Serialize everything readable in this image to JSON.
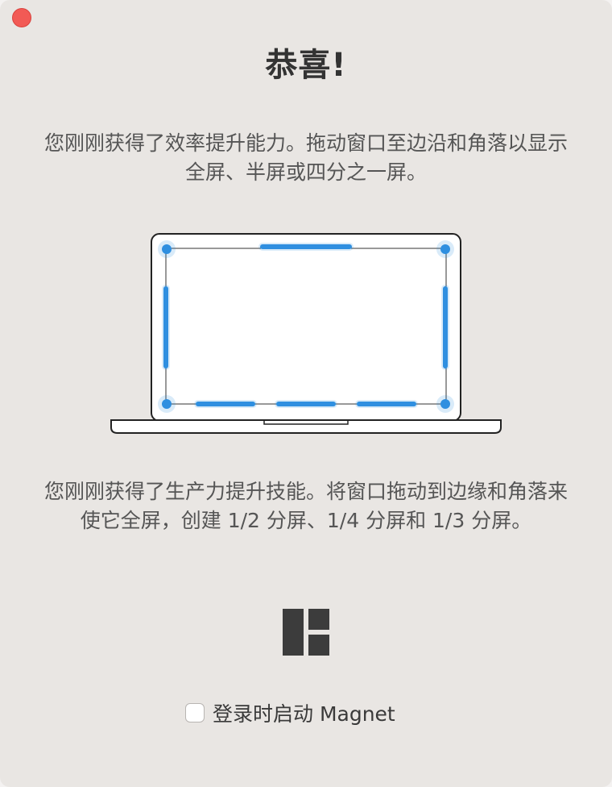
{
  "window": {
    "close_icon": "close-traffic-light"
  },
  "title": "恭喜!",
  "intro": "您刚刚获得了效率提升能力。拖动窗口至边沿和角落以显示全屏、半屏或四分之一屏。",
  "illustration": {
    "icon": "laptop-snap-zones-illustration"
  },
  "description": "您刚刚获得了生产力提升技能。将窗口拖动到边缘和角落来使它全屏，创建 1/2 分屏、1/4 分屏和 1/3 分屏。",
  "app_icon": "magnet-layout-icon",
  "launch_at_login": {
    "checked": false,
    "label": "登录时启动 Magnet"
  },
  "colors": {
    "accent": "#2f8fe0",
    "close": "#f25a55",
    "background": "#e9e6e3"
  }
}
